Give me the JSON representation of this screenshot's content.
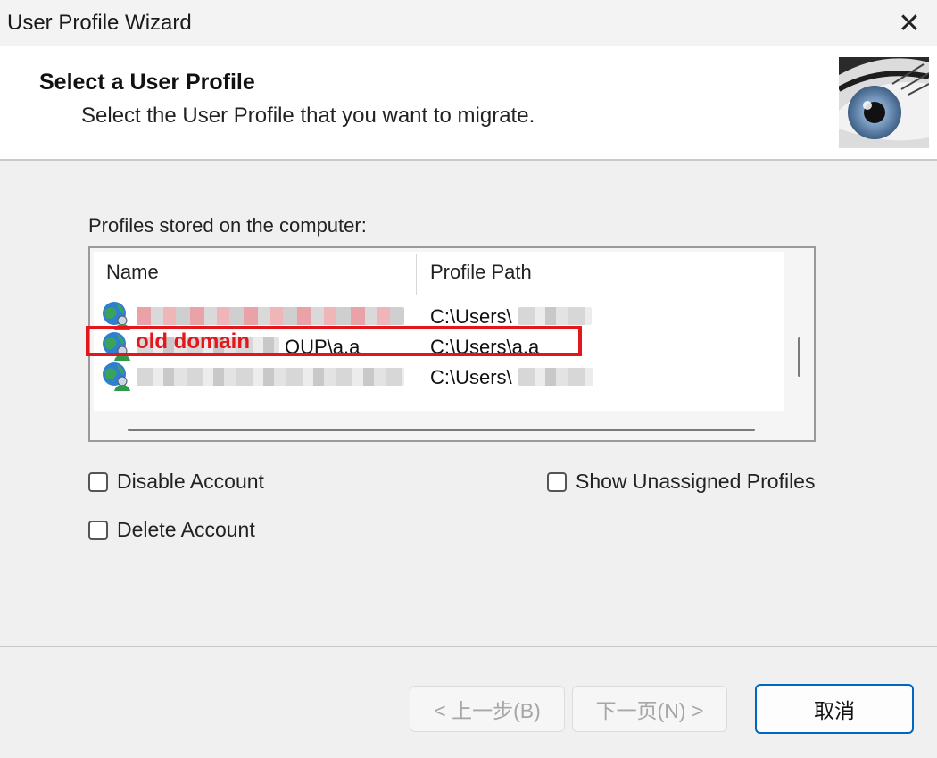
{
  "window": {
    "title": "User Profile Wizard",
    "close_glyph": "✕"
  },
  "header": {
    "title": "Select a User Profile",
    "subtitle": "Select the User Profile that you want to migrate."
  },
  "profiles": {
    "label": "Profiles stored on the computer:",
    "columns": [
      "Name",
      "Profile Path"
    ],
    "rows": [
      {
        "name": "",
        "path": "C:\\Users\\",
        "icon": "user-globe-icon"
      },
      {
        "name": "OUP\\a.a",
        "path": "C:\\Users\\a.a",
        "icon": "user-globe-icon"
      },
      {
        "name": "",
        "path": "C:\\Users\\",
        "icon": "user-globe-icon"
      }
    ],
    "annotation": "old domain"
  },
  "options": {
    "disable_account": "Disable Account",
    "delete_account": "Delete Account",
    "show_unassigned": "Show Unassigned Profiles"
  },
  "buttons": {
    "back": "< 上一步(B)",
    "next": "下一页(N) >",
    "cancel": "取消"
  },
  "colors": {
    "annotation": "#e3161b",
    "accent": "#0067c0"
  }
}
